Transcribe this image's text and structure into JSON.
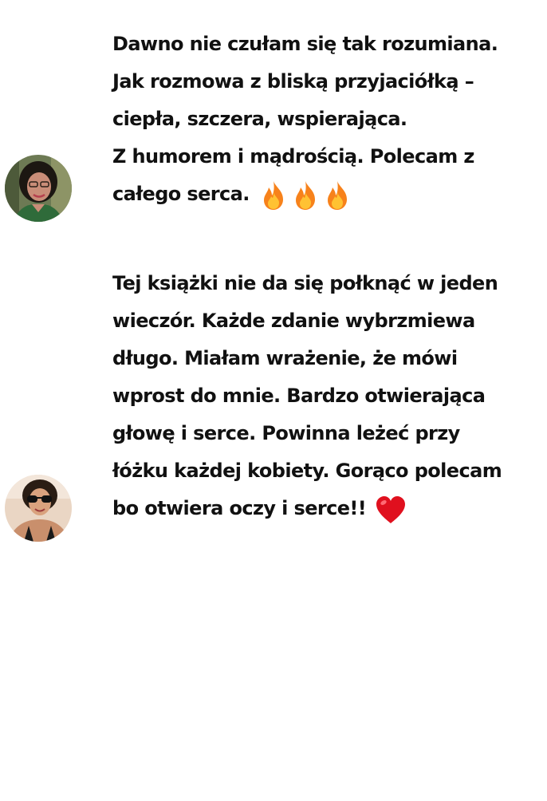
{
  "reviews": [
    {
      "lines": [
        "Dawno nie czułam się tak rozumiana.",
        "Jak rozmowa z bliską przyjaciółką –",
        "ciepła, szczera, wspierająca.",
        "Z humorem i mądrością. Polecam z",
        "całego serca."
      ],
      "reaction_icon": "fire-icon",
      "reaction_count": 3,
      "avatar_icon": "avatar-photo-woman-glasses"
    },
    {
      "lines": [
        "Tej książki nie da się połknąć w jeden",
        "wieczór. Każde zdanie wybrzmiewa",
        "długo. Miałam wrażenie, że mówi",
        "wprost do mnie. Bardzo otwierająca",
        "głowę i serce. Powinna leżeć przy",
        "łóżku każdej kobiety. Gorąco polecam",
        "bo otwiera oczy i serce!!"
      ],
      "reaction_icon": "heart-icon",
      "reaction_count": 1,
      "avatar_icon": "avatar-photo-woman-sunglasses"
    }
  ],
  "colors": {
    "text": "#111111",
    "fire": "#f7821b",
    "heart": "#e0101e",
    "background": "#ffffff"
  }
}
